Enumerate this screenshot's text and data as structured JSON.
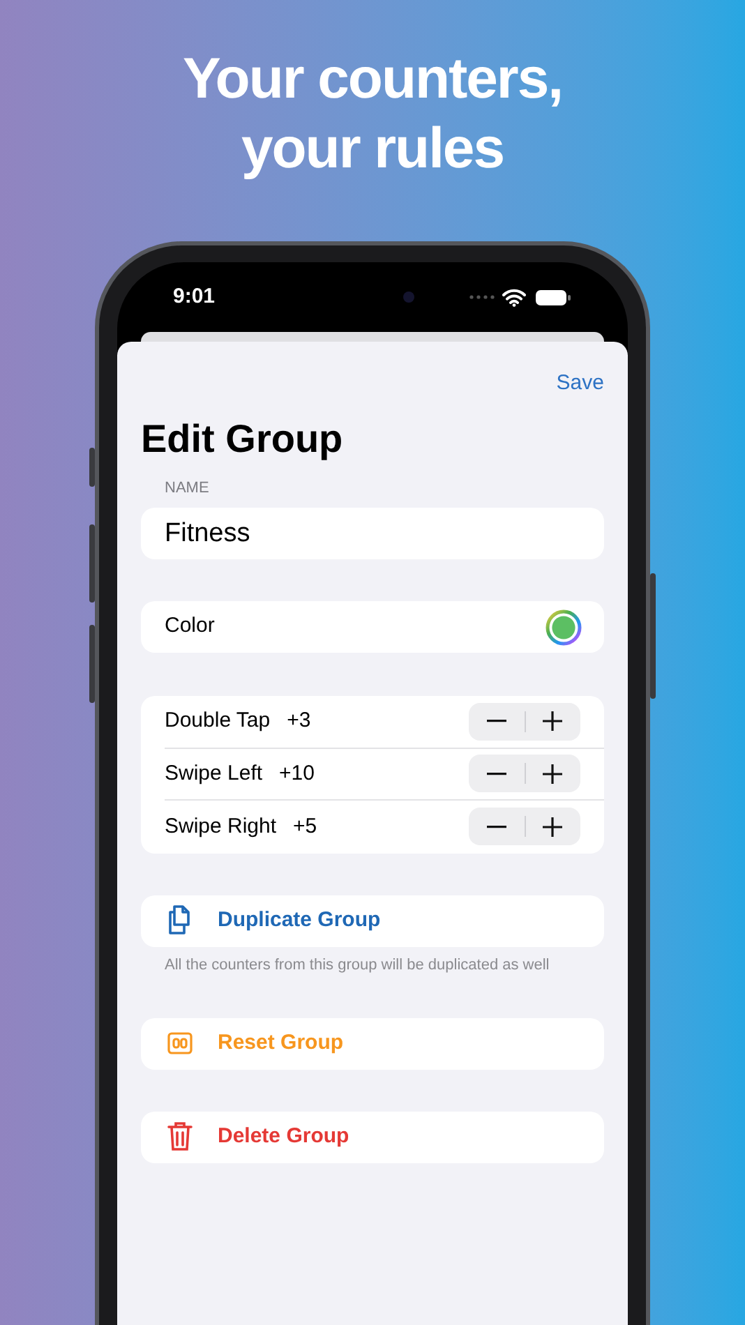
{
  "headline": [
    "Your counters,",
    "your rules"
  ],
  "status_bar": {
    "time": "9:01"
  },
  "nav": {
    "save": "Save"
  },
  "title": "Edit Group",
  "name_field": {
    "label": "NAME",
    "value": "Fitness"
  },
  "color_row": {
    "label": "Color",
    "color": "#5cbf63"
  },
  "gestures": [
    {
      "label": "Double Tap",
      "value": "+3"
    },
    {
      "label": "Swipe Left",
      "value": "+10"
    },
    {
      "label": "Swipe Right",
      "value": "+5"
    }
  ],
  "actions": [
    {
      "kind": "duplicate",
      "label": "Duplicate Group",
      "color": "#1f68b5",
      "note": "All the counters from this group will be duplicated as well"
    },
    {
      "kind": "reset",
      "label": "Reset Group",
      "color": "#f7961e"
    },
    {
      "kind": "delete",
      "label": "Delete Group",
      "color": "#e53935"
    }
  ]
}
